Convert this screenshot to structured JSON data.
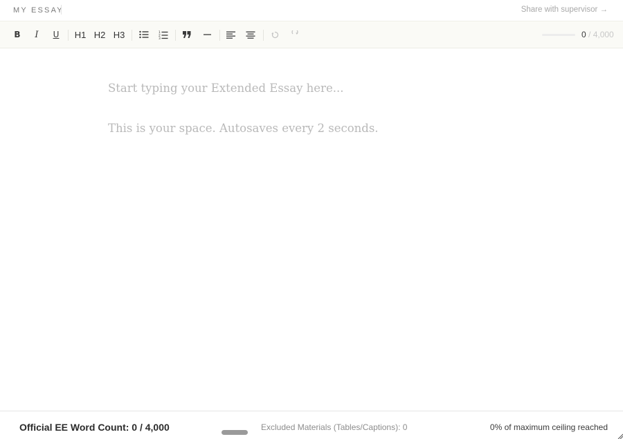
{
  "header": {
    "brand": "MY ESSAY",
    "share_link": "Share with supervisor →"
  },
  "toolbar": {
    "bold": "B",
    "italic": "I",
    "underline": "U",
    "h1": "H1",
    "h2": "H2",
    "h3": "H3",
    "icons": [
      "bullet-list-icon",
      "numbered-list-icon",
      "quote-icon",
      "horizontal-rule-icon",
      "align-left-icon",
      "align-center-icon",
      "undo-icon",
      "redo-icon"
    ],
    "word_count_current": "0",
    "word_count_max": " / 4,000",
    "progress_fraction": 0
  },
  "editor": {
    "placeholder_line1": "Start typing your Extended Essay here...",
    "placeholder_line2": "This is your space. Autosaves every 2 seconds."
  },
  "footer": {
    "word_count_label": "Official EE Word Count: 0 / 4,000",
    "excluded_label": "Excluded Materials (Tables/Captions): 0",
    "ceiling_label": "0% of maximum ceiling reached"
  },
  "colors": {
    "toolbar_bg": "#fafaf6",
    "placeholder": "#b9b9b9",
    "muted": "#a8a8a8"
  }
}
